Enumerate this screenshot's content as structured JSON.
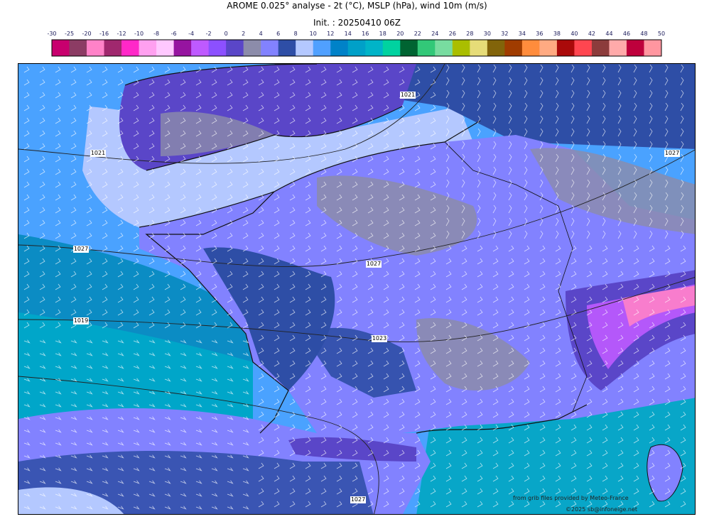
{
  "header": {
    "title": "AROME 0.025° analyse - 2t (°C), MSLP (hPa), wind 10m (m/s)",
    "init": "Init. : 20250410 06Z"
  },
  "colorbar": {
    "ticks": [
      "-30",
      "-25",
      "-20",
      "-16",
      "-12",
      "-10",
      "-8",
      "-6",
      "-4",
      "-2",
      "0",
      "2",
      "4",
      "6",
      "8",
      "10",
      "12",
      "14",
      "16",
      "18",
      "20",
      "22",
      "24",
      "26",
      "28",
      "30",
      "32",
      "34",
      "36",
      "38",
      "40",
      "42",
      "44",
      "46",
      "48",
      "50"
    ],
    "colors": [
      "#c8006e",
      "#8c3c64",
      "#ff82c8",
      "#a0286e",
      "#ff28c8",
      "#ffa0f0",
      "#ffc8ff",
      "#9614a0",
      "#be5aff",
      "#8c50ff",
      "#5a46c8",
      "#8c8caa",
      "#8282ff",
      "#2e4ea6",
      "#b4c8ff",
      "#50a0ff",
      "#0082c8",
      "#00a0c8",
      "#00b4c8",
      "#00d2a0",
      "#006432",
      "#32c878",
      "#78dca0",
      "#aabe00",
      "#e6dc78",
      "#82640a",
      "#a03c00",
      "#ff8c3c",
      "#ffaa82",
      "#aa0a0a",
      "#ff4650",
      "#8c3c3c",
      "#ffaaaa",
      "#be003c",
      "#ff96a0"
    ]
  },
  "isobars": [
    "1021",
    "1021",
    "1027",
    "1027",
    "1027",
    "1023",
    "1023",
    "1027",
    "1019"
  ],
  "credits": {
    "source": "from grib files provided by Meteo-France",
    "copyright": "©2025 sb@infoneige.net"
  }
}
